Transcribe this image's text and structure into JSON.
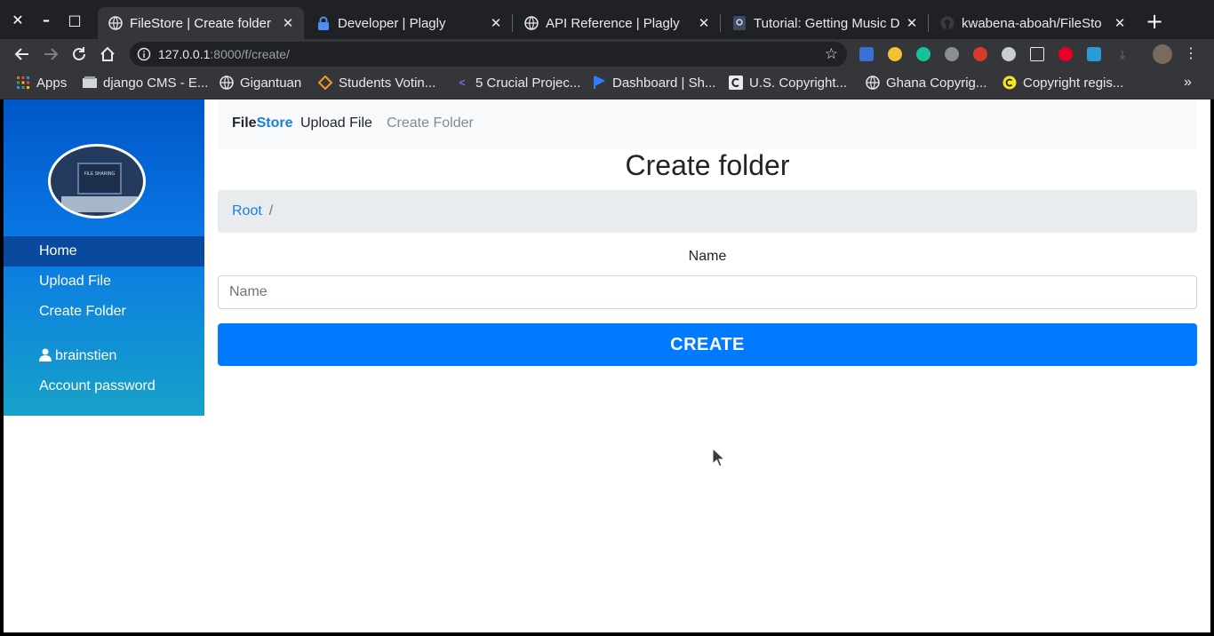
{
  "window": {
    "close": "✕",
    "minimize": "–",
    "maximize": "□"
  },
  "tabs": [
    {
      "title": "FileStore | Create folder",
      "active": true,
      "icon": "globe-icon"
    },
    {
      "title": "Developer | Plagly",
      "active": false,
      "icon": "lock-icon"
    },
    {
      "title": "API Reference | Plagly",
      "active": false,
      "icon": "globe-icon"
    },
    {
      "title": "Tutorial: Getting Music D",
      "active": false,
      "icon": "badge-icon"
    },
    {
      "title": "kwabena-aboah/FileSto",
      "active": false,
      "icon": "github-icon"
    }
  ],
  "tab_close": "✕",
  "new_tab": "+",
  "address_bar": {
    "host": "127.0.0.1",
    "rest": ":8000/f/create/"
  },
  "bookmarks": [
    {
      "label": "Apps",
      "icon": "apps-grid-icon"
    },
    {
      "label": "django CMS - E...",
      "icon": "cms-icon"
    },
    {
      "label": "Gigantuan",
      "icon": "globe-icon"
    },
    {
      "label": "Students Votin...",
      "icon": "diamond-icon"
    },
    {
      "label": "5 Crucial Projec...",
      "icon": "chevron-icon"
    },
    {
      "label": "Dashboard | Sh...",
      "icon": "flag-icon"
    },
    {
      "label": "U.S. Copyright...",
      "icon": "copyright-icon"
    },
    {
      "label": "Ghana Copyrig...",
      "icon": "globe-icon"
    },
    {
      "label": "Copyright regis...",
      "icon": "copyright-yellow-icon"
    }
  ],
  "bookmarks_overflow": "»",
  "sidebar": {
    "items": [
      {
        "label": "Home",
        "active": true
      },
      {
        "label": "Upload File",
        "active": false
      },
      {
        "label": "Create Folder",
        "active": false
      },
      {
        "label": "brainstien",
        "active": false,
        "icon": "user-icon"
      },
      {
        "label": "Account password",
        "active": false
      }
    ],
    "logo_caption": "FILE SHARING"
  },
  "navbar": {
    "brand_part1": "File",
    "brand_part2": "Store",
    "upload": "Upload File",
    "create": "Create Folder"
  },
  "page_title": "Create folder",
  "breadcrumb": {
    "root": "Root",
    "separator": "/"
  },
  "form": {
    "name_label": "Name",
    "name_placeholder": "Name",
    "name_value": "",
    "submit": "CREATE"
  },
  "colors": {
    "primary": "#007bff",
    "link": "#1a7ee0",
    "sidebar_top": "#0056c8",
    "sidebar_bottom": "#17a2c8"
  }
}
